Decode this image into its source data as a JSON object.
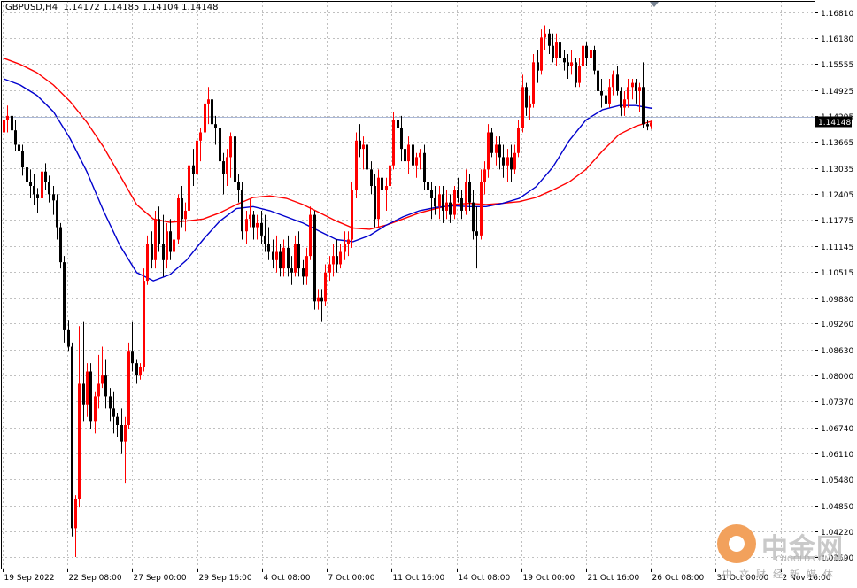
{
  "header": {
    "symbol": "GBPUSD,H4",
    "open": "1.14172",
    "high": "1.14185",
    "low": "1.14104",
    "close": "1.14148"
  },
  "current_price_label": "1.14148",
  "watermark": {
    "title": "中金网",
    "site": "CNGOLD.COM.CN",
    "subtitle": "中文财经新媒体"
  },
  "colors": {
    "bull": "#ff0000",
    "bear": "#000000",
    "ma_red": "#ff0000",
    "ma_blue": "#0000cd",
    "grid": "#c0c0c0",
    "price_line": "#c0c0c0",
    "price_label_bg": "#000000"
  },
  "chart_data": {
    "type": "candlestick",
    "grid": true,
    "y_ticks": [
      "1.16810",
      "1.16180",
      "1.15555",
      "1.14925",
      "1.14295",
      "1.13665",
      "1.13035",
      "1.12405",
      "1.11775",
      "1.11145",
      "1.10515",
      "1.09880",
      "1.09260",
      "1.08630",
      "1.08000",
      "1.07370",
      "1.06740",
      "1.06110",
      "1.05480",
      "1.04850",
      "1.04220",
      "1.03590"
    ],
    "y_range": [
      1.0332,
      1.1709
    ],
    "x_labels": [
      "19 Sep 2022",
      "22 Sep 08:00",
      "27 Sep 00:00",
      "29 Sep 16:00",
      "4 Oct 08:00",
      "7 Oct 00:00",
      "11 Oct 16:00",
      "14 Oct 08:00",
      "19 Oct 00:00",
      "21 Oct 16:00",
      "26 Oct 08:00",
      "31 Oct 00:00",
      "2 Nov 16:00"
    ],
    "series": [
      {
        "name": "",
        "type": "ma",
        "color": "#ff0000",
        "values": [
          1.157,
          1.1555,
          1.1535,
          1.1505,
          1.1465,
          1.1415,
          1.1355,
          1.1285,
          1.1215,
          1.118,
          1.1172,
          1.1175,
          1.118,
          1.1195,
          1.1215,
          1.1232,
          1.1236,
          1.123,
          1.1215,
          1.1195,
          1.1175,
          1.1158,
          1.1155,
          1.1165,
          1.118,
          1.1195,
          1.1205,
          1.1215,
          1.1218,
          1.1215,
          1.1218,
          1.1222,
          1.1232,
          1.125,
          1.127,
          1.13,
          1.1345,
          1.1385,
          1.1405,
          1.1418
        ]
      },
      {
        "name": "",
        "type": "ma",
        "color": "#0000cd",
        "values": [
          1.152,
          1.1505,
          1.148,
          1.144,
          1.1375,
          1.1295,
          1.12,
          1.1115,
          1.105,
          1.103,
          1.1045,
          1.108,
          1.113,
          1.1175,
          1.1205,
          1.121,
          1.12,
          1.1185,
          1.117,
          1.115,
          1.113,
          1.1125,
          1.114,
          1.1165,
          1.1185,
          1.12,
          1.1208,
          1.1212,
          1.121,
          1.121,
          1.1218,
          1.123,
          1.1258,
          1.1305,
          1.137,
          1.142,
          1.1445,
          1.1455,
          1.1455,
          1.1448
        ]
      }
    ],
    "candles": [
      {
        "o": 1.139,
        "h": 1.145,
        "l": 1.1365,
        "c": 1.142
      },
      {
        "o": 1.142,
        "h": 1.1455,
        "l": 1.139,
        "c": 1.143
      },
      {
        "o": 1.143,
        "h": 1.1445,
        "l": 1.138,
        "c": 1.1395
      },
      {
        "o": 1.1395,
        "h": 1.142,
        "l": 1.1345,
        "c": 1.136
      },
      {
        "o": 1.136,
        "h": 1.138,
        "l": 1.132,
        "c": 1.1345
      },
      {
        "o": 1.1345,
        "h": 1.136,
        "l": 1.1285,
        "c": 1.1305
      },
      {
        "o": 1.1305,
        "h": 1.133,
        "l": 1.1255,
        "c": 1.127
      },
      {
        "o": 1.127,
        "h": 1.13,
        "l": 1.123,
        "c": 1.126
      },
      {
        "o": 1.126,
        "h": 1.129,
        "l": 1.1215,
        "c": 1.124
      },
      {
        "o": 1.124,
        "h": 1.1255,
        "l": 1.1195,
        "c": 1.123
      },
      {
        "o": 1.123,
        "h": 1.131,
        "l": 1.122,
        "c": 1.1295
      },
      {
        "o": 1.1295,
        "h": 1.1315,
        "l": 1.125,
        "c": 1.127
      },
      {
        "o": 1.127,
        "h": 1.1285,
        "l": 1.122,
        "c": 1.124
      },
      {
        "o": 1.124,
        "h": 1.126,
        "l": 1.119,
        "c": 1.1225
      },
      {
        "o": 1.1225,
        "h": 1.124,
        "l": 1.113,
        "c": 1.116
      },
      {
        "o": 1.116,
        "h": 1.117,
        "l": 1.106,
        "c": 1.1075
      },
      {
        "o": 1.1075,
        "h": 1.109,
        "l": 1.088,
        "c": 1.091
      },
      {
        "o": 1.091,
        "h": 1.0935,
        "l": 1.086,
        "c": 1.087
      },
      {
        "o": 1.087,
        "h": 1.088,
        "l": 1.041,
        "c": 1.043
      },
      {
        "o": 1.043,
        "h": 1.051,
        "l": 1.036,
        "c": 1.05
      },
      {
        "o": 1.05,
        "h": 1.092,
        "l": 1.048,
        "c": 1.078
      },
      {
        "o": 1.078,
        "h": 1.093,
        "l": 1.069,
        "c": 1.073
      },
      {
        "o": 1.073,
        "h": 1.083,
        "l": 1.07,
        "c": 1.081
      },
      {
        "o": 1.081,
        "h": 1.083,
        "l": 1.067,
        "c": 1.069
      },
      {
        "o": 1.069,
        "h": 1.076,
        "l": 1.066,
        "c": 1.075
      },
      {
        "o": 1.075,
        "h": 1.085,
        "l": 1.072,
        "c": 1.078
      },
      {
        "o": 1.078,
        "h": 1.087,
        "l": 1.077,
        "c": 1.08
      },
      {
        "o": 1.08,
        "h": 1.084,
        "l": 1.072,
        "c": 1.075
      },
      {
        "o": 1.075,
        "h": 1.077,
        "l": 1.069,
        "c": 1.072
      },
      {
        "o": 1.072,
        "h": 1.076,
        "l": 1.066,
        "c": 1.07
      },
      {
        "o": 1.07,
        "h": 1.071,
        "l": 1.065,
        "c": 1.068
      },
      {
        "o": 1.068,
        "h": 1.072,
        "l": 1.061,
        "c": 1.064
      },
      {
        "o": 1.064,
        "h": 1.07,
        "l": 1.054,
        "c": 1.068
      },
      {
        "o": 1.068,
        "h": 1.088,
        "l": 1.067,
        "c": 1.086
      },
      {
        "o": 1.086,
        "h": 1.093,
        "l": 1.081,
        "c": 1.083
      },
      {
        "o": 1.083,
        "h": 1.084,
        "l": 1.078,
        "c": 1.08
      },
      {
        "o": 1.08,
        "h": 1.083,
        "l": 1.079,
        "c": 1.082
      },
      {
        "o": 1.082,
        "h": 1.106,
        "l": 1.081,
        "c": 1.103
      },
      {
        "o": 1.103,
        "h": 1.114,
        "l": 1.102,
        "c": 1.112
      },
      {
        "o": 1.112,
        "h": 1.115,
        "l": 1.106,
        "c": 1.108
      },
      {
        "o": 1.108,
        "h": 1.12,
        "l": 1.106,
        "c": 1.118
      },
      {
        "o": 1.118,
        "h": 1.121,
        "l": 1.11,
        "c": 1.112
      },
      {
        "o": 1.112,
        "h": 1.119,
        "l": 1.104,
        "c": 1.108
      },
      {
        "o": 1.108,
        "h": 1.117,
        "l": 1.106,
        "c": 1.115
      },
      {
        "o": 1.115,
        "h": 1.118,
        "l": 1.108,
        "c": 1.11
      },
      {
        "o": 1.11,
        "h": 1.115,
        "l": 1.107,
        "c": 1.113
      },
      {
        "o": 1.113,
        "h": 1.124,
        "l": 1.112,
        "c": 1.123
      },
      {
        "o": 1.123,
        "h": 1.126,
        "l": 1.116,
        "c": 1.118
      },
      {
        "o": 1.118,
        "h": 1.122,
        "l": 1.115,
        "c": 1.12
      },
      {
        "o": 1.12,
        "h": 1.133,
        "l": 1.119,
        "c": 1.131
      },
      {
        "o": 1.131,
        "h": 1.135,
        "l": 1.126,
        "c": 1.129
      },
      {
        "o": 1.129,
        "h": 1.139,
        "l": 1.128,
        "c": 1.137
      },
      {
        "o": 1.137,
        "h": 1.14,
        "l": 1.132,
        "c": 1.139
      },
      {
        "o": 1.139,
        "h": 1.148,
        "l": 1.138,
        "c": 1.146
      },
      {
        "o": 1.146,
        "h": 1.15,
        "l": 1.141,
        "c": 1.147
      },
      {
        "o": 1.147,
        "h": 1.149,
        "l": 1.138,
        "c": 1.141
      },
      {
        "o": 1.141,
        "h": 1.143,
        "l": 1.136,
        "c": 1.14
      },
      {
        "o": 1.14,
        "h": 1.141,
        "l": 1.13,
        "c": 1.132
      },
      {
        "o": 1.132,
        "h": 1.134,
        "l": 1.124,
        "c": 1.129
      },
      {
        "o": 1.129,
        "h": 1.135,
        "l": 1.126,
        "c": 1.133
      },
      {
        "o": 1.133,
        "h": 1.139,
        "l": 1.128,
        "c": 1.138
      },
      {
        "o": 1.138,
        "h": 1.139,
        "l": 1.124,
        "c": 1.127
      },
      {
        "o": 1.127,
        "h": 1.129,
        "l": 1.122,
        "c": 1.125
      },
      {
        "o": 1.125,
        "h": 1.127,
        "l": 1.113,
        "c": 1.115
      },
      {
        "o": 1.115,
        "h": 1.12,
        "l": 1.112,
        "c": 1.118
      },
      {
        "o": 1.118,
        "h": 1.123,
        "l": 1.116,
        "c": 1.119
      },
      {
        "o": 1.119,
        "h": 1.12,
        "l": 1.113,
        "c": 1.116
      },
      {
        "o": 1.116,
        "h": 1.119,
        "l": 1.113,
        "c": 1.117
      },
      {
        "o": 1.117,
        "h": 1.12,
        "l": 1.112,
        "c": 1.114
      },
      {
        "o": 1.114,
        "h": 1.119,
        "l": 1.11,
        "c": 1.112
      },
      {
        "o": 1.112,
        "h": 1.116,
        "l": 1.108,
        "c": 1.11
      },
      {
        "o": 1.11,
        "h": 1.113,
        "l": 1.106,
        "c": 1.108
      },
      {
        "o": 1.108,
        "h": 1.114,
        "l": 1.105,
        "c": 1.11
      },
      {
        "o": 1.11,
        "h": 1.112,
        "l": 1.104,
        "c": 1.106
      },
      {
        "o": 1.106,
        "h": 1.113,
        "l": 1.104,
        "c": 1.111
      },
      {
        "o": 1.111,
        "h": 1.114,
        "l": 1.104,
        "c": 1.106
      },
      {
        "o": 1.106,
        "h": 1.109,
        "l": 1.102,
        "c": 1.105
      },
      {
        "o": 1.105,
        "h": 1.114,
        "l": 1.104,
        "c": 1.112
      },
      {
        "o": 1.112,
        "h": 1.115,
        "l": 1.104,
        "c": 1.106
      },
      {
        "o": 1.106,
        "h": 1.108,
        "l": 1.102,
        "c": 1.104
      },
      {
        "o": 1.104,
        "h": 1.111,
        "l": 1.102,
        "c": 1.109
      },
      {
        "o": 1.109,
        "h": 1.121,
        "l": 1.108,
        "c": 1.119
      },
      {
        "o": 1.119,
        "h": 1.12,
        "l": 1.096,
        "c": 1.098
      },
      {
        "o": 1.098,
        "h": 1.101,
        "l": 1.096,
        "c": 1.099
      },
      {
        "o": 1.099,
        "h": 1.101,
        "l": 1.093,
        "c": 1.098
      },
      {
        "o": 1.098,
        "h": 1.107,
        "l": 1.097,
        "c": 1.105
      },
      {
        "o": 1.105,
        "h": 1.109,
        "l": 1.103,
        "c": 1.107
      },
      {
        "o": 1.107,
        "h": 1.112,
        "l": 1.104,
        "c": 1.109
      },
      {
        "o": 1.109,
        "h": 1.113,
        "l": 1.105,
        "c": 1.107
      },
      {
        "o": 1.107,
        "h": 1.112,
        "l": 1.106,
        "c": 1.11
      },
      {
        "o": 1.11,
        "h": 1.115,
        "l": 1.108,
        "c": 1.112
      },
      {
        "o": 1.112,
        "h": 1.115,
        "l": 1.109,
        "c": 1.113
      },
      {
        "o": 1.113,
        "h": 1.127,
        "l": 1.111,
        "c": 1.125
      },
      {
        "o": 1.125,
        "h": 1.139,
        "l": 1.123,
        "c": 1.137
      },
      {
        "o": 1.137,
        "h": 1.141,
        "l": 1.133,
        "c": 1.135
      },
      {
        "o": 1.135,
        "h": 1.138,
        "l": 1.13,
        "c": 1.136
      },
      {
        "o": 1.136,
        "h": 1.137,
        "l": 1.128,
        "c": 1.13
      },
      {
        "o": 1.13,
        "h": 1.132,
        "l": 1.124,
        "c": 1.126
      },
      {
        "o": 1.126,
        "h": 1.129,
        "l": 1.116,
        "c": 1.118
      },
      {
        "o": 1.118,
        "h": 1.13,
        "l": 1.116,
        "c": 1.128
      },
      {
        "o": 1.128,
        "h": 1.13,
        "l": 1.123,
        "c": 1.125
      },
      {
        "o": 1.125,
        "h": 1.128,
        "l": 1.12,
        "c": 1.126
      },
      {
        "o": 1.126,
        "h": 1.133,
        "l": 1.124,
        "c": 1.131
      },
      {
        "o": 1.131,
        "h": 1.144,
        "l": 1.13,
        "c": 1.142
      },
      {
        "o": 1.142,
        "h": 1.145,
        "l": 1.138,
        "c": 1.14
      },
      {
        "o": 1.14,
        "h": 1.143,
        "l": 1.132,
        "c": 1.135
      },
      {
        "o": 1.135,
        "h": 1.137,
        "l": 1.13,
        "c": 1.132
      },
      {
        "o": 1.132,
        "h": 1.138,
        "l": 1.129,
        "c": 1.136
      },
      {
        "o": 1.136,
        "h": 1.138,
        "l": 1.129,
        "c": 1.131
      },
      {
        "o": 1.131,
        "h": 1.134,
        "l": 1.128,
        "c": 1.133
      },
      {
        "o": 1.133,
        "h": 1.135,
        "l": 1.13,
        "c": 1.134
      },
      {
        "o": 1.134,
        "h": 1.136,
        "l": 1.125,
        "c": 1.127
      },
      {
        "o": 1.127,
        "h": 1.129,
        "l": 1.122,
        "c": 1.125
      },
      {
        "o": 1.125,
        "h": 1.127,
        "l": 1.118,
        "c": 1.123
      },
      {
        "o": 1.123,
        "h": 1.126,
        "l": 1.119,
        "c": 1.121
      },
      {
        "o": 1.121,
        "h": 1.126,
        "l": 1.118,
        "c": 1.124
      },
      {
        "o": 1.124,
        "h": 1.126,
        "l": 1.117,
        "c": 1.12
      },
      {
        "o": 1.12,
        "h": 1.125,
        "l": 1.118,
        "c": 1.122
      },
      {
        "o": 1.122,
        "h": 1.124,
        "l": 1.117,
        "c": 1.119
      },
      {
        "o": 1.119,
        "h": 1.126,
        "l": 1.118,
        "c": 1.125
      },
      {
        "o": 1.125,
        "h": 1.128,
        "l": 1.122,
        "c": 1.123
      },
      {
        "o": 1.123,
        "h": 1.125,
        "l": 1.118,
        "c": 1.12
      },
      {
        "o": 1.12,
        "h": 1.13,
        "l": 1.119,
        "c": 1.127
      },
      {
        "o": 1.127,
        "h": 1.129,
        "l": 1.12,
        "c": 1.122
      },
      {
        "o": 1.122,
        "h": 1.125,
        "l": 1.113,
        "c": 1.115
      },
      {
        "o": 1.115,
        "h": 1.121,
        "l": 1.106,
        "c": 1.114
      },
      {
        "o": 1.114,
        "h": 1.13,
        "l": 1.113,
        "c": 1.127
      },
      {
        "o": 1.127,
        "h": 1.132,
        "l": 1.124,
        "c": 1.13
      },
      {
        "o": 1.13,
        "h": 1.141,
        "l": 1.128,
        "c": 1.139
      },
      {
        "o": 1.139,
        "h": 1.14,
        "l": 1.133,
        "c": 1.134
      },
      {
        "o": 1.134,
        "h": 1.138,
        "l": 1.131,
        "c": 1.136
      },
      {
        "o": 1.136,
        "h": 1.138,
        "l": 1.13,
        "c": 1.133
      },
      {
        "o": 1.133,
        "h": 1.136,
        "l": 1.128,
        "c": 1.131
      },
      {
        "o": 1.131,
        "h": 1.135,
        "l": 1.127,
        "c": 1.133
      },
      {
        "o": 1.133,
        "h": 1.136,
        "l": 1.127,
        "c": 1.13
      },
      {
        "o": 1.13,
        "h": 1.136,
        "l": 1.129,
        "c": 1.134
      },
      {
        "o": 1.134,
        "h": 1.142,
        "l": 1.133,
        "c": 1.14
      },
      {
        "o": 1.14,
        "h": 1.153,
        "l": 1.139,
        "c": 1.15
      },
      {
        "o": 1.15,
        "h": 1.151,
        "l": 1.143,
        "c": 1.145
      },
      {
        "o": 1.145,
        "h": 1.148,
        "l": 1.142,
        "c": 1.146
      },
      {
        "o": 1.146,
        "h": 1.158,
        "l": 1.145,
        "c": 1.156
      },
      {
        "o": 1.156,
        "h": 1.159,
        "l": 1.151,
        "c": 1.154
      },
      {
        "o": 1.154,
        "h": 1.164,
        "l": 1.153,
        "c": 1.162
      },
      {
        "o": 1.162,
        "h": 1.165,
        "l": 1.159,
        "c": 1.163
      },
      {
        "o": 1.163,
        "h": 1.164,
        "l": 1.158,
        "c": 1.16
      },
      {
        "o": 1.16,
        "h": 1.163,
        "l": 1.156,
        "c": 1.157
      },
      {
        "o": 1.157,
        "h": 1.163,
        "l": 1.155,
        "c": 1.161
      },
      {
        "o": 1.161,
        "h": 1.163,
        "l": 1.156,
        "c": 1.157
      },
      {
        "o": 1.157,
        "h": 1.159,
        "l": 1.154,
        "c": 1.156
      },
      {
        "o": 1.156,
        "h": 1.158,
        "l": 1.152,
        "c": 1.155
      },
      {
        "o": 1.155,
        "h": 1.159,
        "l": 1.153,
        "c": 1.156
      },
      {
        "o": 1.156,
        "h": 1.157,
        "l": 1.15,
        "c": 1.151
      },
      {
        "o": 1.151,
        "h": 1.157,
        "l": 1.15,
        "c": 1.155
      },
      {
        "o": 1.155,
        "h": 1.162,
        "l": 1.154,
        "c": 1.16
      },
      {
        "o": 1.16,
        "h": 1.161,
        "l": 1.155,
        "c": 1.157
      },
      {
        "o": 1.157,
        "h": 1.161,
        "l": 1.156,
        "c": 1.159
      },
      {
        "o": 1.159,
        "h": 1.16,
        "l": 1.153,
        "c": 1.154
      },
      {
        "o": 1.154,
        "h": 1.155,
        "l": 1.147,
        "c": 1.149
      },
      {
        "o": 1.149,
        "h": 1.152,
        "l": 1.145,
        "c": 1.148
      },
      {
        "o": 1.148,
        "h": 1.15,
        "l": 1.144,
        "c": 1.146
      },
      {
        "o": 1.146,
        "h": 1.152,
        "l": 1.145,
        "c": 1.15
      },
      {
        "o": 1.15,
        "h": 1.154,
        "l": 1.148,
        "c": 1.153
      },
      {
        "o": 1.153,
        "h": 1.155,
        "l": 1.148,
        "c": 1.149
      },
      {
        "o": 1.149,
        "h": 1.15,
        "l": 1.143,
        "c": 1.145
      },
      {
        "o": 1.145,
        "h": 1.149,
        "l": 1.143,
        "c": 1.147
      },
      {
        "o": 1.147,
        "h": 1.152,
        "l": 1.145,
        "c": 1.15
      },
      {
        "o": 1.15,
        "h": 1.152,
        "l": 1.147,
        "c": 1.151
      },
      {
        "o": 1.151,
        "h": 1.152,
        "l": 1.146,
        "c": 1.149
      },
      {
        "o": 1.149,
        "h": 1.151,
        "l": 1.144,
        "c": 1.15
      },
      {
        "o": 1.15,
        "h": 1.156,
        "l": 1.14,
        "c": 1.141
      },
      {
        "o": 1.141,
        "h": 1.142,
        "l": 1.1395,
        "c": 1.1405
      },
      {
        "o": 1.1405,
        "h": 1.1418,
        "l": 1.1398,
        "c": 1.1414
      }
    ]
  }
}
